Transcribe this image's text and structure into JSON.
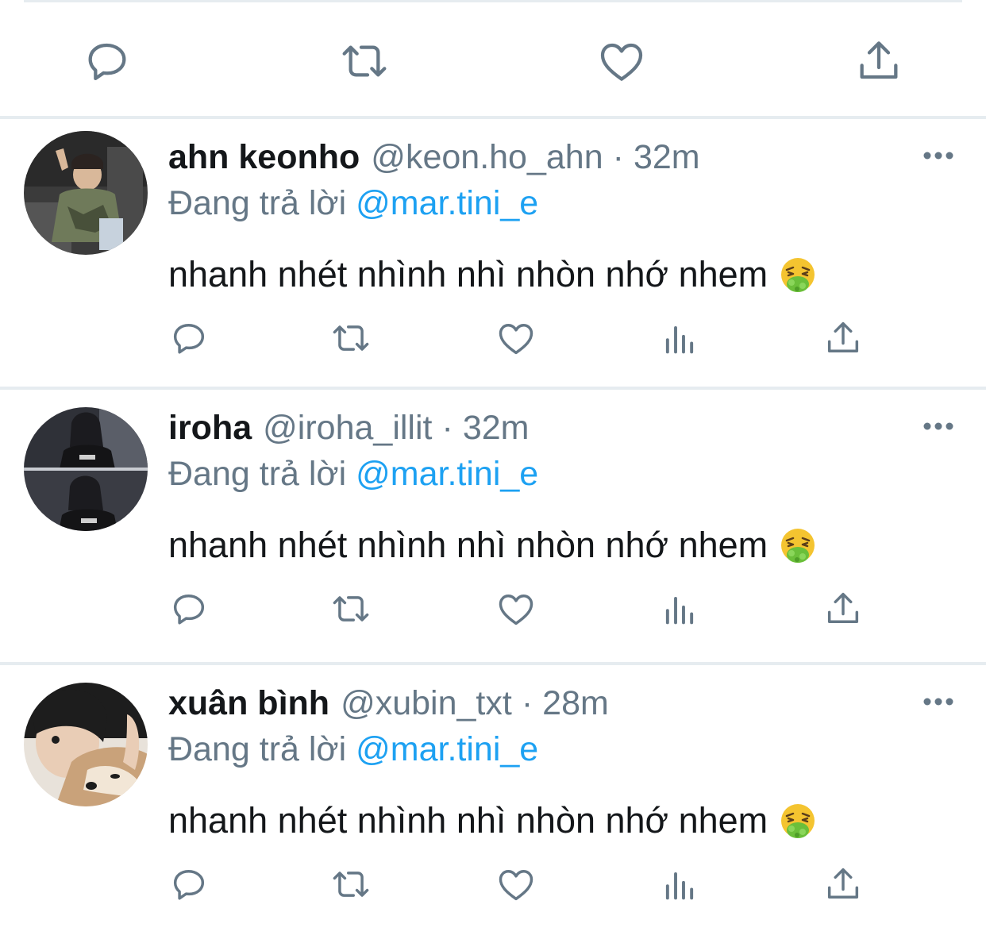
{
  "top_actions": {
    "icons": [
      "reply-icon",
      "retweet-icon",
      "like-icon",
      "share-icon"
    ]
  },
  "replies": [
    {
      "name": "ahn keonho",
      "handle": "@keon.ho_ahn",
      "separator": "·",
      "time": "32m",
      "replying_prefix": "Đang trả lời",
      "replying_to": "@mar.tini_e",
      "text": "nhanh nhét nhình nhì nhòn nhớ nhem",
      "emoji": "nauseated-face-icon",
      "avatar_colors": {
        "bg": "#3b3b3b",
        "accent": "#6f7a5a"
      }
    },
    {
      "name": "iroha",
      "handle": "@iroha_illit",
      "separator": "·",
      "time": "32m",
      "replying_prefix": "Đang trả lời",
      "replying_to": "@mar.tini_e",
      "text": "nhanh nhét nhình nhì nhòn nhớ nhem",
      "emoji": "nauseated-face-icon",
      "avatar_colors": {
        "bg": "#2a2a2e",
        "accent": "#8a8f9a"
      }
    },
    {
      "name": "xuân bình",
      "handle": "@xubin_txt",
      "separator": "·",
      "time": "28m",
      "replying_prefix": "Đang trả lời",
      "replying_to": "@mar.tini_e",
      "text": "nhanh nhét nhình nhì nhòn nhớ nhem",
      "emoji": "nauseated-face-icon",
      "avatar_colors": {
        "bg": "#c9a27a",
        "accent": "#1d1d1d"
      }
    }
  ],
  "colors": {
    "text": "#14171a",
    "secondary": "#657786",
    "link": "#1da1f2",
    "divider": "#e6ecf0",
    "icon": "#657786"
  }
}
